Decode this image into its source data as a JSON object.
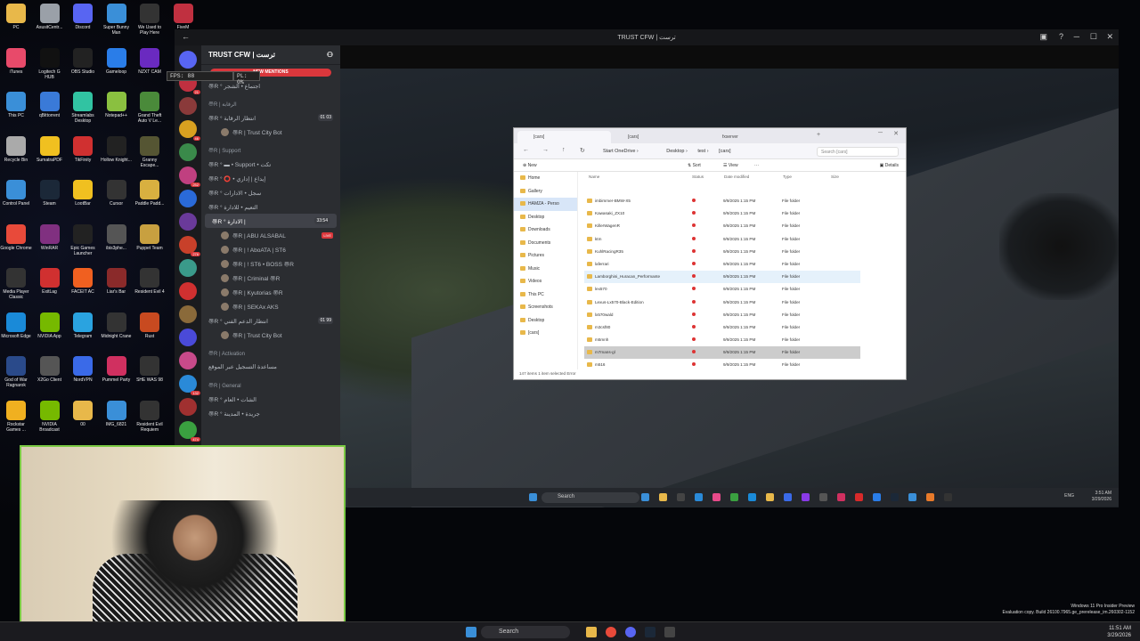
{
  "desktop_icons": [
    {
      "label": "PC",
      "color": "#e8b84a"
    },
    {
      "label": "AsusitCentr...",
      "color": "#9aa0a8"
    },
    {
      "label": "Discord",
      "color": "#5865f2"
    },
    {
      "label": "Super Bunny Man",
      "color": "#3a8fd8"
    },
    {
      "label": "We Used to Play Here",
      "color": "#333"
    },
    {
      "label": "FiveM",
      "color": "#c03040"
    },
    {
      "label": "iTunes",
      "color": "#e84a6a"
    },
    {
      "label": "Logitech G HUB",
      "color": "#111"
    },
    {
      "label": "OBS Studio",
      "color": "#222"
    },
    {
      "label": "Gameloop",
      "color": "#2a7de8"
    },
    {
      "label": "NZXT CAM",
      "color": "#6a2ac0"
    },
    {
      "label": "This PC",
      "color": "#3a8fd8"
    },
    {
      "label": "qBittorrent",
      "color": "#3a7ad8"
    },
    {
      "label": "Streamlabs Desktop",
      "color": "#31c3a2"
    },
    {
      "label": "Notepad++",
      "color": "#8ac040"
    },
    {
      "label": "Grand Theft Auto V Le...",
      "color": "#4a8a3a"
    },
    {
      "label": "Recycle Bin",
      "color": "#aaa"
    },
    {
      "label": "SumatraPDF",
      "color": "#f0c020"
    },
    {
      "label": "TikFinity",
      "color": "#d03030"
    },
    {
      "label": "Hollow Knight...",
      "color": "#222"
    },
    {
      "label": "Granny Escape...",
      "color": "#553"
    },
    {
      "label": "Control Panel",
      "color": "#3a8fd8"
    },
    {
      "label": "Steam",
      "color": "#1b2838"
    },
    {
      "label": "LootBar",
      "color": "#f0c020"
    },
    {
      "label": "Cursor",
      "color": "#333"
    },
    {
      "label": "Paddle Padd...",
      "color": "#d8b040"
    },
    {
      "label": "Google Chrome",
      "color": "#e84a3a"
    },
    {
      "label": "WinRAR",
      "color": "#803080"
    },
    {
      "label": "Epic Games Launcher",
      "color": "#222"
    },
    {
      "label": "ibis3phe...",
      "color": "#555"
    },
    {
      "label": "Puppet Team",
      "color": "#c8a040"
    },
    {
      "label": "Media Player Classic",
      "color": "#333"
    },
    {
      "label": "ExitLag",
      "color": "#d03030"
    },
    {
      "label": "FACEIT AC",
      "color": "#f06020"
    },
    {
      "label": "Liar's Bar",
      "color": "#8a2a2a"
    },
    {
      "label": "Resident Evil 4",
      "color": "#333"
    },
    {
      "label": "Microsoft Edge",
      "color": "#1a8ad8"
    },
    {
      "label": "NVIDIA App",
      "color": "#76b900"
    },
    {
      "label": "Telegram",
      "color": "#2aa3e0"
    },
    {
      "label": "Midnight Crane",
      "color": "#333"
    },
    {
      "label": "Rust",
      "color": "#c84a20"
    },
    {
      "label": "God of War Ragnarok",
      "color": "#2a4a8a"
    },
    {
      "label": "X2Go Client",
      "color": "#555"
    },
    {
      "label": "NordVPN",
      "color": "#3a6ae8"
    },
    {
      "label": "Pummel Party",
      "color": "#d03060"
    },
    {
      "label": "SHE WAS 98",
      "color": "#333"
    },
    {
      "label": "Rockstar Games ...",
      "color": "#f0b020"
    },
    {
      "label": "NVIDIA Broadcast",
      "color": "#76b900"
    },
    {
      "label": "00",
      "color": "#e8b84a"
    },
    {
      "label": "IMG_6821",
      "color": "#3a8fd8"
    },
    {
      "label": "Resident Evil Requiem",
      "color": "#333"
    }
  ],
  "window": {
    "title": "TRUST CFW | ترست"
  },
  "discord": {
    "server_name": "TRUST CFW | ترست",
    "new_mentions": "NEW MENTIONS",
    "server_badges": [
      "",
      "21",
      "",
      "46",
      "",
      "252",
      "",
      "",
      "276",
      "",
      "",
      "",
      "",
      "",
      "132",
      "",
      "474"
    ],
    "channels": [
      {
        "kind": "ch",
        "text": "〠R ° اجتماع • الشجر"
      },
      {
        "kind": "cat",
        "text": "〠R | الرقابة"
      },
      {
        "kind": "ch",
        "text": "〠R ° انتظار الرقابة",
        "count": "01 03"
      },
      {
        "kind": "sub",
        "text": "〠R | Trust City Bot"
      },
      {
        "kind": "cat",
        "text": "〠R | Support"
      },
      {
        "kind": "ch",
        "text": "〠R ° ▬ • Support • تكت"
      },
      {
        "kind": "ch",
        "text": "〠R ° ⭕ • إيداع | إداري"
      },
      {
        "kind": "ch",
        "text": "〠R ° سجل • الادارات"
      },
      {
        "kind": "ch",
        "text": "〠R ° التعيم • للادارة"
      },
      {
        "kind": "active",
        "text": "〠R ° الادارة |",
        "count": "33:54"
      },
      {
        "kind": "sub",
        "text": "〠R | ABU ALSABAL",
        "live": "LIVE"
      },
      {
        "kind": "sub",
        "text": "〠R | ! AboATA | ST6"
      },
      {
        "kind": "sub",
        "text": "〠R | ! ST6 • BOSS 〠R"
      },
      {
        "kind": "sub",
        "text": "〠R | Criminal 〠R"
      },
      {
        "kind": "sub",
        "text": "〠R | Kyutorias 〠R"
      },
      {
        "kind": "sub",
        "text": "〠R | SEKAx AKS"
      },
      {
        "kind": "ch",
        "text": "〠R ° انتظار الدعم الفني",
        "count": "01 99"
      },
      {
        "kind": "sub",
        "text": "〠R | Trust City Bot"
      },
      {
        "kind": "cat",
        "text": "〠R | Activation"
      },
      {
        "kind": "ch",
        "text": "مساعدة التسجيل عبر الموقع"
      },
      {
        "kind": "cat",
        "text": "〠R | General"
      },
      {
        "kind": "ch",
        "text": "〠R ° الشات • العام"
      },
      {
        "kind": "ch",
        "text": "〠R ° جريدة • المدينة"
      }
    ]
  },
  "game": {
    "fps": "FPS: 88",
    "pl": "PL: 0%"
  },
  "vm_taskbar": {
    "search": "Search",
    "lang": "ENG",
    "time": "3:51 AM",
    "date": "3/29/2026"
  },
  "explorer": {
    "tabs": [
      "[cars]",
      "[cars]",
      "fxserver"
    ],
    "path": [
      "Start OneDrive",
      "Desktop",
      "test",
      "[cars]"
    ],
    "search_placeholder": "Search [cars]",
    "cmd": {
      "new": "New",
      "sort": "Sort",
      "view": "View",
      "details": "Details"
    },
    "nav": [
      "Home",
      "Gallery",
      "HAMZA - Perso",
      "Desktop",
      "Downloads",
      "Documents",
      "Pictures",
      "Music",
      "Videos",
      "This PC",
      "Screenshots",
      "Desktop",
      "[cars]"
    ],
    "columns": {
      "name": "Name",
      "status": "Status",
      "date": "Date modified",
      "type": "Type",
      "size": "Size"
    },
    "rows": [
      {
        "name": "imbimmer-BMW-X5",
        "date": "9/9/2025 1:15 PM",
        "type": "File folder"
      },
      {
        "name": "Kawasaki_ZX10",
        "date": "9/9/2025 1:15 PM",
        "type": "File folder"
      },
      {
        "name": "KillerWagenR",
        "date": "9/9/2025 1:15 PM",
        "type": "File folder"
      },
      {
        "name": "ktm",
        "date": "9/9/2025 1:15 PM",
        "type": "File folder"
      },
      {
        "name": "KuhlRacingR35",
        "date": "9/9/2025 1:15 PM",
        "type": "File folder"
      },
      {
        "name": "laferrari",
        "date": "9/9/2025 1:15 PM",
        "type": "File folder"
      },
      {
        "name": "Lamborghini_Huracan_Performante",
        "date": "9/9/2025 1:15 PM",
        "type": "File folder"
      },
      {
        "name": "lex570",
        "date": "9/9/2025 1:15 PM",
        "type": "File folder"
      },
      {
        "name": "Lexus-Lx570-Black-Edition",
        "date": "9/9/2025 1:15 PM",
        "type": "File folder"
      },
      {
        "name": "lx570wald",
        "date": "9/9/2025 1:15 PM",
        "type": "File folder"
      },
      {
        "name": "m3csf80",
        "date": "9/9/2025 1:15 PM",
        "type": "File folder"
      },
      {
        "name": "m5mnh",
        "date": "9/9/2025 1:15 PM",
        "type": "File folder"
      },
      {
        "name": "m7mans-gl",
        "date": "9/9/2025 1:15 PM",
        "type": "File folder"
      },
      {
        "name": "m516",
        "date": "9/9/2025 1:15 PM",
        "type": "File folder"
      }
    ],
    "status": "147 items    1 item selected    Error"
  },
  "host_taskbar": {
    "search": "Search",
    "time": "11:51 AM",
    "date": "3/29/2026"
  },
  "watermark": {
    "line1": "Windows 11 Pro Insider Preview",
    "line2": "Evaluation copy. Build 26100.7965.ge_prerelease_im.260302-1152"
  }
}
